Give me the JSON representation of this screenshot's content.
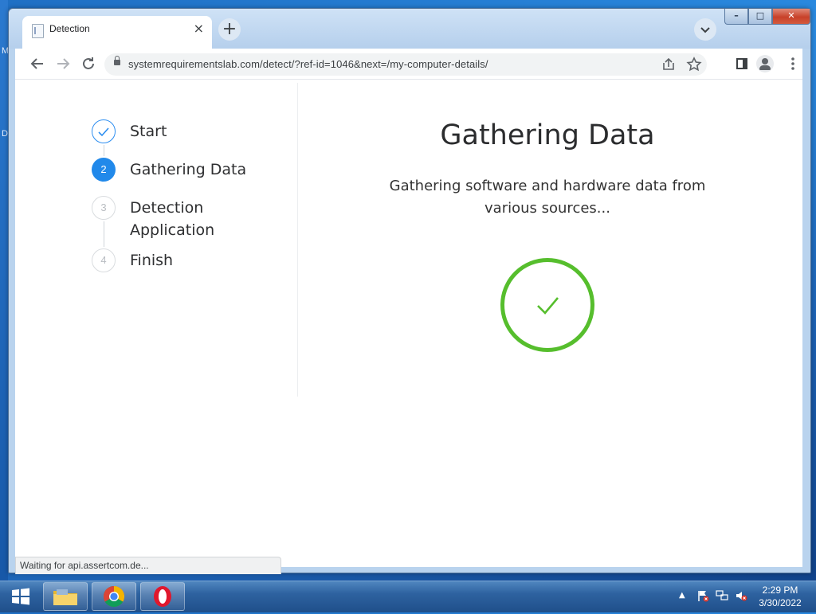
{
  "desktop": {
    "edge_letters": [
      "M",
      "D"
    ]
  },
  "browser": {
    "tab": {
      "title": "Detection",
      "close_glyph": "×"
    },
    "new_tab_glyph": "+",
    "tab_search_glyph": "⌄",
    "caption": {
      "minimize": "–",
      "maximize": "□",
      "close": "✕"
    },
    "url": "systemrequirementslab.com/detect/?ref-id=1046&next=/my-computer-details/",
    "status_text": "Waiting for api.assertcom.de..."
  },
  "page": {
    "steps": [
      {
        "number": "✓",
        "label": "Start",
        "state": "done"
      },
      {
        "number": "2",
        "label": "Gathering Data",
        "state": "active"
      },
      {
        "number": "3",
        "label": "Detection Application",
        "state": "todo"
      },
      {
        "number": "4",
        "label": "Finish",
        "state": "todo"
      }
    ],
    "title": "Gathering Data",
    "subtitle": "Gathering software and hardware data from various sources...",
    "accent_color": "#2189ea",
    "success_color": "#56be2d"
  },
  "taskbar": {
    "apps": [
      "windows-explorer",
      "google-chrome",
      "opera"
    ],
    "time": "2:29 PM",
    "date": "3/30/2022"
  }
}
